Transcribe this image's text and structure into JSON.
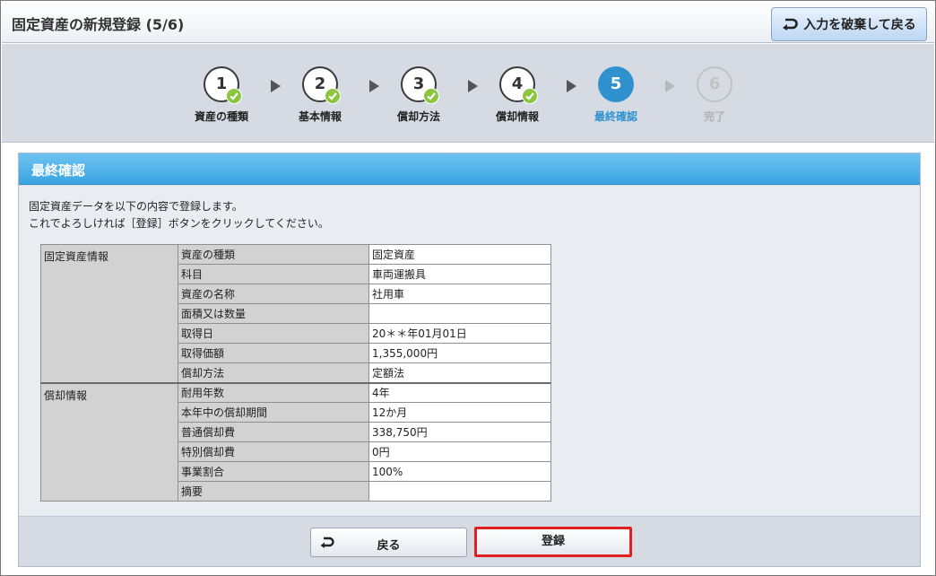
{
  "header": {
    "title": "固定資産の新規登録 (5/6)",
    "discard_label": "入力を破棄して戻る"
  },
  "steps": [
    {
      "num": "1",
      "label": "資産の種類",
      "state": "done"
    },
    {
      "num": "2",
      "label": "基本情報",
      "state": "done"
    },
    {
      "num": "3",
      "label": "償却方法",
      "state": "done"
    },
    {
      "num": "4",
      "label": "償却情報",
      "state": "done"
    },
    {
      "num": "5",
      "label": "最終確認",
      "state": "active"
    },
    {
      "num": "6",
      "label": "完了",
      "state": "todo"
    }
  ],
  "panel": {
    "title": "最終確認",
    "intro_line1": "固定資産データを以下の内容で登録します。",
    "intro_line2": "これでよろしければ［登録］ボタンをクリックしてください。"
  },
  "table": {
    "sections": [
      {
        "name": "固定資産情報",
        "rows": [
          {
            "label": "資産の種類",
            "value": "固定資産"
          },
          {
            "label": "科目",
            "value": "車両運搬具"
          },
          {
            "label": "資産の名称",
            "value": "社用車"
          },
          {
            "label": "面積又は数量",
            "value": ""
          },
          {
            "label": "取得日",
            "value": "20＊＊年01月01日"
          },
          {
            "label": "取得価額",
            "value": "1,355,000円"
          },
          {
            "label": "償却方法",
            "value": "定額法"
          }
        ]
      },
      {
        "name": "償却情報",
        "rows": [
          {
            "label": "耐用年数",
            "value": "4年"
          },
          {
            "label": "本年中の償却期間",
            "value": "12か月"
          },
          {
            "label": "普通償却費",
            "value": "338,750円"
          },
          {
            "label": "特別償却費",
            "value": "0円"
          },
          {
            "label": "事業割合",
            "value": "100%"
          },
          {
            "label": "摘要",
            "value": ""
          }
        ]
      }
    ]
  },
  "footer": {
    "back_label": "戻る",
    "register_label": "登録"
  },
  "colors": {
    "accent": "#2f92cf",
    "check": "#8cc63f",
    "highlight": "#e02020"
  }
}
